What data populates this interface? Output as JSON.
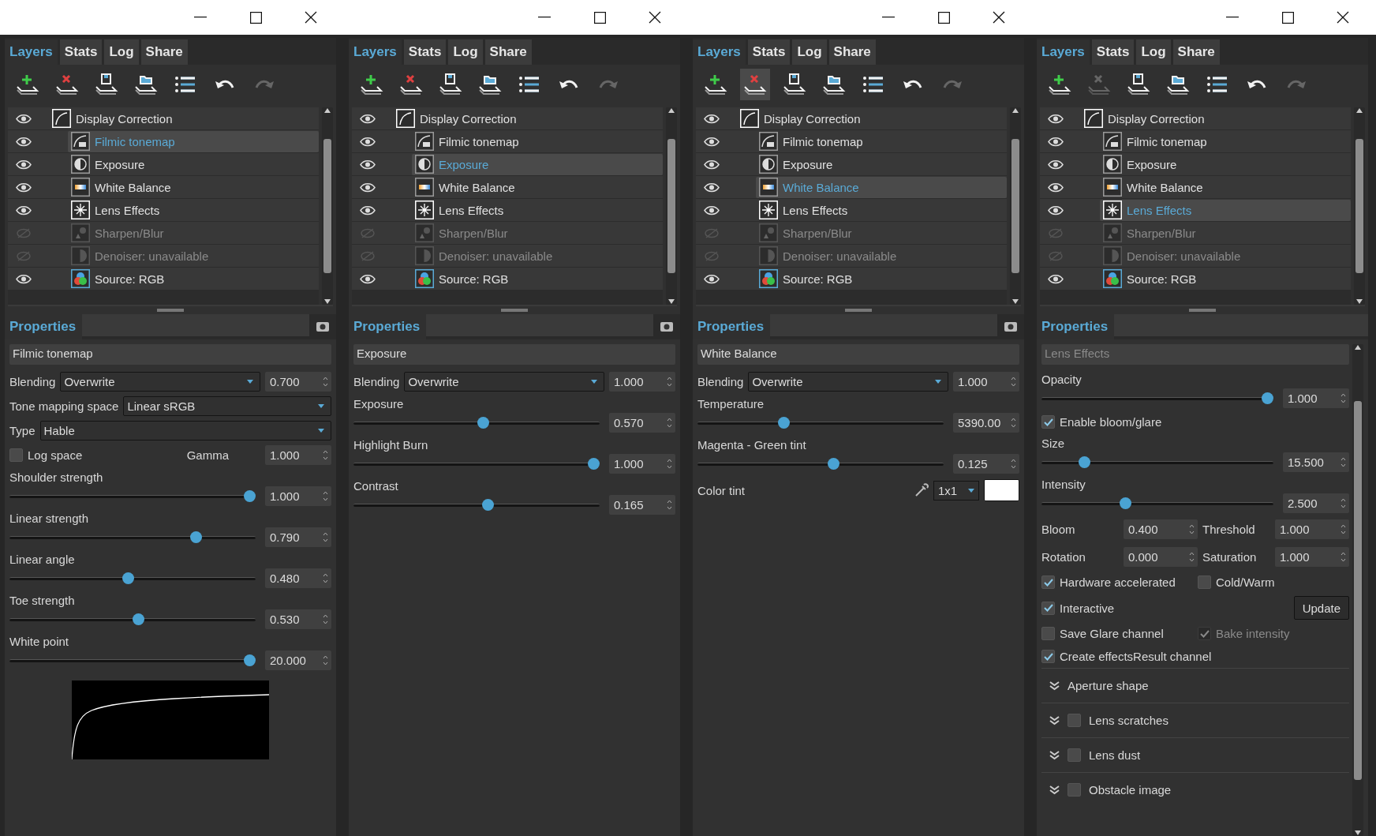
{
  "panels": [
    {
      "tabs": [
        {
          "label": "Layers",
          "selected": true
        },
        {
          "label": "Stats",
          "selected": false
        },
        {
          "label": "Log",
          "selected": false
        },
        {
          "label": "Share",
          "selected": false
        }
      ],
      "toolbar": [
        {
          "kind": "add",
          "disabled": false,
          "hovered": false
        },
        {
          "kind": "remove",
          "disabled": false,
          "hovered": false
        },
        {
          "kind": "save",
          "disabled": false,
          "hovered": false
        },
        {
          "kind": "open",
          "disabled": false,
          "hovered": false
        },
        {
          "kind": "list",
          "disabled": false,
          "hovered": false
        },
        {
          "kind": "undo",
          "disabled": false,
          "hovered": false
        },
        {
          "kind": "redo",
          "disabled": true,
          "hovered": false
        }
      ],
      "layers": [
        {
          "name": "Display Correction",
          "kind": "curve",
          "visible": true,
          "selected": false,
          "children": [
            {
              "name": "Filmic tonemap",
              "kind": "filmic",
              "visible": true,
              "selected": true
            },
            {
              "name": "Exposure",
              "kind": "exposure",
              "visible": true,
              "selected": false
            },
            {
              "name": "White Balance",
              "kind": "balance",
              "visible": true,
              "selected": false
            },
            {
              "name": "Lens Effects",
              "kind": "lens",
              "visible": true,
              "selected": false
            },
            {
              "name": "Sharpen/Blur",
              "kind": "sharpen",
              "visible": false,
              "selected": false
            },
            {
              "name": "Denoiser: unavailable",
              "kind": "denoise",
              "visible": false,
              "selected": false
            },
            {
              "name": "Source: RGB",
              "kind": "rgb",
              "visible": true,
              "selected": false
            }
          ]
        }
      ],
      "properties": {
        "title": "Properties",
        "snapshot": true,
        "layer_name": "Filmic tonemap",
        "name_disabled": false,
        "scrollable": false,
        "controls": [
          {
            "kind": "blending",
            "label": "Blending",
            "value": "Overwrite",
            "number": "0.700"
          },
          {
            "kind": "select",
            "label": "Tone mapping space",
            "value": "Linear sRGB"
          },
          {
            "kind": "select",
            "label": "Type",
            "value": "Hable"
          },
          {
            "kind": "check_number",
            "label": "Log space",
            "checked": false,
            "number_label": "Gamma",
            "number": "1.000"
          },
          {
            "kind": "slider",
            "label": "Shoulder strength",
            "level": 1.0,
            "number": "1.000"
          },
          {
            "kind": "slider",
            "label": "Linear strength",
            "level": 0.77,
            "number": "0.790"
          },
          {
            "kind": "slider",
            "label": "Linear angle",
            "level": 0.48,
            "number": "0.480"
          },
          {
            "kind": "slider",
            "label": "Toe strength",
            "level": 0.525,
            "number": "0.530"
          },
          {
            "kind": "slider",
            "label": "White point",
            "level": 1.0,
            "number": "20.000"
          },
          {
            "kind": "curve"
          }
        ]
      }
    },
    {
      "tabs": [
        {
          "label": "Layers",
          "selected": true
        },
        {
          "label": "Stats",
          "selected": false
        },
        {
          "label": "Log",
          "selected": false
        },
        {
          "label": "Share",
          "selected": false
        }
      ],
      "toolbar": [
        {
          "kind": "add",
          "disabled": false,
          "hovered": false
        },
        {
          "kind": "remove",
          "disabled": false,
          "hovered": false
        },
        {
          "kind": "save",
          "disabled": false,
          "hovered": false
        },
        {
          "kind": "open",
          "disabled": false,
          "hovered": false
        },
        {
          "kind": "list",
          "disabled": false,
          "hovered": false
        },
        {
          "kind": "undo",
          "disabled": false,
          "hovered": false
        },
        {
          "kind": "redo",
          "disabled": true,
          "hovered": false
        }
      ],
      "layers": [
        {
          "name": "Display Correction",
          "kind": "curve",
          "visible": true,
          "selected": false,
          "children": [
            {
              "name": "Filmic tonemap",
              "kind": "filmic",
              "visible": true,
              "selected": false
            },
            {
              "name": "Exposure",
              "kind": "exposure",
              "visible": true,
              "selected": true
            },
            {
              "name": "White Balance",
              "kind": "balance",
              "visible": true,
              "selected": false
            },
            {
              "name": "Lens Effects",
              "kind": "lens",
              "visible": true,
              "selected": false
            },
            {
              "name": "Sharpen/Blur",
              "kind": "sharpen",
              "visible": false,
              "selected": false
            },
            {
              "name": "Denoiser: unavailable",
              "kind": "denoise",
              "visible": false,
              "selected": false
            },
            {
              "name": "Source: RGB",
              "kind": "rgb",
              "visible": true,
              "selected": false
            }
          ]
        }
      ],
      "properties": {
        "title": "Properties",
        "snapshot": true,
        "layer_name": "Exposure",
        "name_disabled": false,
        "scrollable": false,
        "controls": [
          {
            "kind": "blending",
            "label": "Blending",
            "value": "Overwrite",
            "number": "1.000"
          },
          {
            "kind": "slider",
            "label": "Exposure",
            "level": 0.53,
            "number": "0.570"
          },
          {
            "kind": "slider",
            "label": "Highlight Burn",
            "level": 1.0,
            "number": "1.000"
          },
          {
            "kind": "slider",
            "label": "Contrast",
            "level": 0.55,
            "number": "0.165"
          }
        ]
      }
    },
    {
      "tabs": [
        {
          "label": "Layers",
          "selected": true
        },
        {
          "label": "Stats",
          "selected": false
        },
        {
          "label": "Log",
          "selected": false
        },
        {
          "label": "Share",
          "selected": false
        }
      ],
      "toolbar": [
        {
          "kind": "add",
          "disabled": false,
          "hovered": false
        },
        {
          "kind": "remove",
          "disabled": false,
          "hovered": true
        },
        {
          "kind": "save",
          "disabled": false,
          "hovered": false
        },
        {
          "kind": "open",
          "disabled": false,
          "hovered": false
        },
        {
          "kind": "list",
          "disabled": false,
          "hovered": false
        },
        {
          "kind": "undo",
          "disabled": false,
          "hovered": false
        },
        {
          "kind": "redo",
          "disabled": true,
          "hovered": false
        }
      ],
      "layers": [
        {
          "name": "Display Correction",
          "kind": "curve",
          "visible": true,
          "selected": false,
          "children": [
            {
              "name": "Filmic tonemap",
              "kind": "filmic",
              "visible": true,
              "selected": false
            },
            {
              "name": "Exposure",
              "kind": "exposure",
              "visible": true,
              "selected": false
            },
            {
              "name": "White Balance",
              "kind": "balance",
              "visible": true,
              "selected": true
            },
            {
              "name": "Lens Effects",
              "kind": "lens",
              "visible": true,
              "selected": false
            },
            {
              "name": "Sharpen/Blur",
              "kind": "sharpen",
              "visible": false,
              "selected": false
            },
            {
              "name": "Denoiser: unavailable",
              "kind": "denoise",
              "visible": false,
              "selected": false
            },
            {
              "name": "Source: RGB",
              "kind": "rgb",
              "visible": true,
              "selected": false
            }
          ]
        }
      ],
      "properties": {
        "title": "Properties",
        "snapshot": true,
        "layer_name": "White Balance",
        "name_disabled": false,
        "scrollable": false,
        "controls": [
          {
            "kind": "blending",
            "label": "Blending",
            "value": "Overwrite",
            "number": "1.000"
          },
          {
            "kind": "slider",
            "label": "Temperature",
            "level": 0.345,
            "number": "5390.00"
          },
          {
            "kind": "slider",
            "label": "Magenta - Green tint",
            "level": 0.555,
            "number": "0.125"
          },
          {
            "kind": "color",
            "label": "Color tint",
            "value": "1x1"
          }
        ]
      }
    },
    {
      "tabs": [
        {
          "label": "Layers",
          "selected": true
        },
        {
          "label": "Stats",
          "selected": false
        },
        {
          "label": "Log",
          "selected": false
        },
        {
          "label": "Share",
          "selected": false
        }
      ],
      "toolbar": [
        {
          "kind": "add",
          "disabled": false,
          "hovered": false
        },
        {
          "kind": "remove",
          "disabled": true,
          "hovered": false
        },
        {
          "kind": "save",
          "disabled": false,
          "hovered": false
        },
        {
          "kind": "open",
          "disabled": false,
          "hovered": false
        },
        {
          "kind": "list",
          "disabled": false,
          "hovered": false
        },
        {
          "kind": "undo",
          "disabled": false,
          "hovered": false
        },
        {
          "kind": "redo",
          "disabled": true,
          "hovered": false
        }
      ],
      "layers": [
        {
          "name": "Display Correction",
          "kind": "curve",
          "visible": true,
          "selected": false,
          "children": [
            {
              "name": "Filmic tonemap",
              "kind": "filmic",
              "visible": true,
              "selected": false
            },
            {
              "name": "Exposure",
              "kind": "exposure",
              "visible": true,
              "selected": false
            },
            {
              "name": "White Balance",
              "kind": "balance",
              "visible": true,
              "selected": false
            },
            {
              "name": "Lens Effects",
              "kind": "lens",
              "visible": true,
              "selected": true
            },
            {
              "name": "Sharpen/Blur",
              "kind": "sharpen",
              "visible": false,
              "selected": false
            },
            {
              "name": "Denoiser: unavailable",
              "kind": "denoise",
              "visible": false,
              "selected": false
            },
            {
              "name": "Source: RGB",
              "kind": "rgb",
              "visible": true,
              "selected": false
            }
          ]
        }
      ],
      "properties": {
        "title": "Properties",
        "snapshot": false,
        "layer_name": "Lens Effects",
        "name_disabled": true,
        "scrollable": true,
        "controls": [
          {
            "kind": "slider",
            "label": "Opacity",
            "level": 1.0,
            "number": "1.000"
          },
          {
            "kind": "checks",
            "items": [
              {
                "label": "Enable bloom/glare",
                "checked": true,
                "disabled": false
              }
            ]
          },
          {
            "kind": "slider",
            "label": "Size",
            "level": 0.17,
            "number": "15.500"
          },
          {
            "kind": "slider",
            "label": "Intensity",
            "level": 0.355,
            "number": "2.500"
          },
          {
            "kind": "pair",
            "items": [
              {
                "label": "Bloom",
                "number": "0.400"
              },
              {
                "label": "Threshold",
                "number": "1.000"
              }
            ]
          },
          {
            "kind": "pair",
            "items": [
              {
                "label": "Rotation",
                "number": "0.000"
              },
              {
                "label": "Saturation",
                "number": "1.000"
              }
            ]
          },
          {
            "kind": "checks",
            "items": [
              {
                "label": "Hardware accelerated",
                "checked": true,
                "disabled": false
              },
              {
                "label": "Cold/Warm",
                "checked": false,
                "disabled": false
              }
            ]
          },
          {
            "kind": "checks",
            "items": [
              {
                "label": "Interactive",
                "checked": true,
                "disabled": false
              }
            ],
            "button": "Update"
          },
          {
            "kind": "checks",
            "items": [
              {
                "label": "Save Glare channel",
                "checked": false,
                "disabled": false
              },
              {
                "label": "Bake intensity",
                "checked": true,
                "disabled": true
              }
            ]
          },
          {
            "kind": "checks",
            "items": [
              {
                "label": "Create effectsResult channel",
                "checked": true,
                "disabled": false
              }
            ]
          },
          {
            "kind": "section",
            "label": "Aperture shape"
          },
          {
            "kind": "section",
            "label": "Lens scratches",
            "checked": false
          },
          {
            "kind": "section",
            "label": "Lens dust",
            "checked": false
          },
          {
            "kind": "section",
            "label": "Obstacle image",
            "checked": false
          }
        ]
      }
    }
  ]
}
